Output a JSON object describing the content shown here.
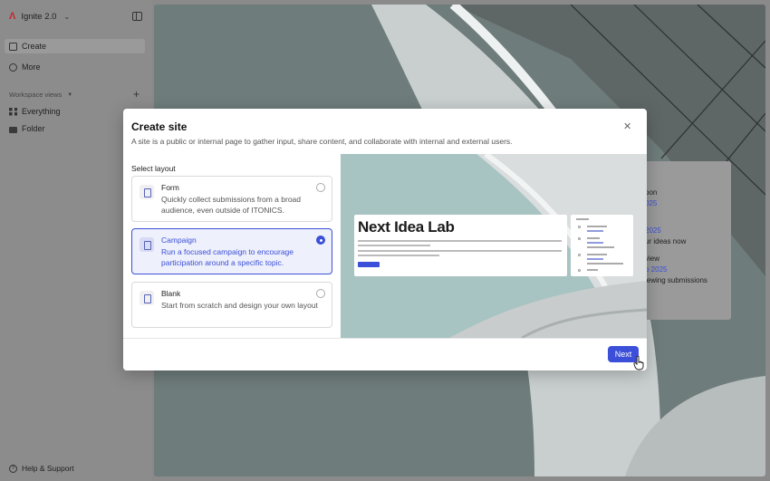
{
  "sidebar": {
    "workspace_name": "Ignite 2.0",
    "items": [
      {
        "label": "Create",
        "icon": "pencil-icon",
        "active": true
      },
      {
        "label": "More",
        "icon": "circle-icon",
        "active": false
      }
    ],
    "section_label": "Workspace views",
    "views": [
      {
        "label": "Everything",
        "icon": "grid-icon"
      },
      {
        "label": "Folder",
        "icon": "folder-icon"
      }
    ],
    "help_label": "Help & Support"
  },
  "background_card": {
    "lines": [
      "oon",
      "025",
      "2025",
      "ur ideas now",
      "view",
      "o 2025",
      "iewing submissions"
    ]
  },
  "modal": {
    "title": "Create site",
    "subtitle": "A site is a public or internal page to gather input, share content, and collaborate with internal and external users.",
    "select_label": "Select layout",
    "options": [
      {
        "title": "Form",
        "description": "Quickly collect submissions from a broad audience, even outside of ITONICS.",
        "selected": false
      },
      {
        "title": "Campaign",
        "description": "Run a focused campaign to encourage participation around a specific topic.",
        "selected": true
      },
      {
        "title": "Blank",
        "description": "Start from scratch and design your own layout",
        "selected": false
      }
    ],
    "preview": {
      "heading": "Next Idea Lab"
    },
    "next_label": "Next"
  },
  "colors": {
    "accent": "#3b4fd8",
    "brand_logo": "#c2282c"
  }
}
